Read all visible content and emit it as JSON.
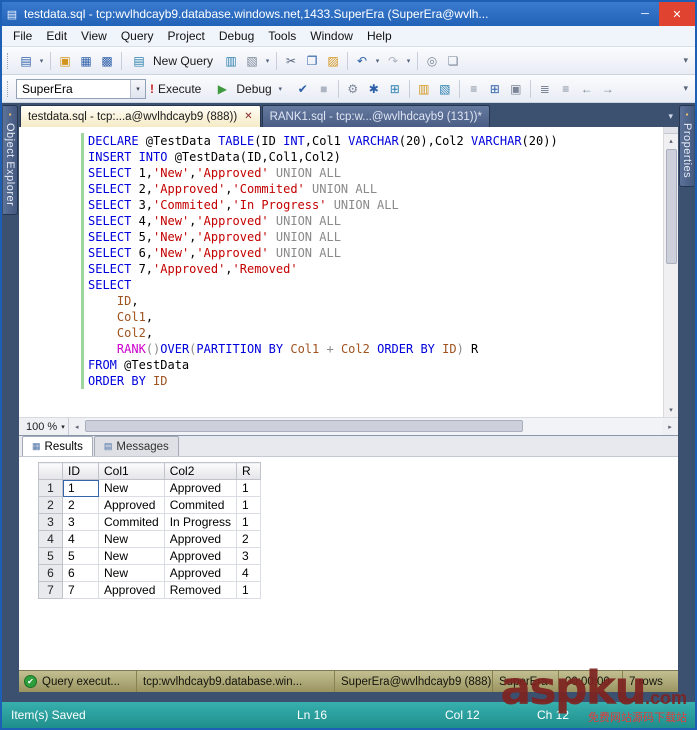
{
  "window": {
    "title": "testdata.sql - tcp:wvlhdcayb9.database.windows.net,1433.SuperEra (SuperEra@wvlh..."
  },
  "menu_bar": {
    "items": [
      "File",
      "Edit",
      "View",
      "Query",
      "Project",
      "Debug",
      "Tools",
      "Window",
      "Help"
    ]
  },
  "toolbars": {
    "standard": {
      "new_query_label": "New Query"
    },
    "sql_editor": {
      "database_combo": "SuperEra",
      "execute_label": "Execute",
      "debug_label": "Debug"
    }
  },
  "doc_tabs": [
    {
      "label": "testdata.sql - tcp:...a@wvlhdcayb9 (888))",
      "active": true
    },
    {
      "label": "RANK1.sql - tcp:w...@wvlhdcayb9 (131))*",
      "active": false
    }
  ],
  "side_panels": {
    "left": "Object Explorer",
    "right": "Properties"
  },
  "editor": {
    "zoom": "100 %",
    "lines": [
      [
        [
          "k",
          "DECLARE"
        ],
        [
          "p",
          " @TestData "
        ],
        [
          "k",
          "TABLE"
        ],
        [
          "p",
          "(ID "
        ],
        [
          "k",
          "INT"
        ],
        [
          "p",
          ",Col1 "
        ],
        [
          "k",
          "VARCHAR"
        ],
        [
          "p",
          "(20),Col2 "
        ],
        [
          "k",
          "VARCHAR"
        ],
        [
          "p",
          "(20))"
        ]
      ],
      [
        [
          "k",
          "INSERT INTO"
        ],
        [
          "p",
          " @TestData(ID,Col1,Col2)"
        ]
      ],
      [
        [
          "k",
          "SELECT"
        ],
        [
          "p",
          " 1,"
        ],
        [
          "s",
          "'New'"
        ],
        [
          "p",
          ","
        ],
        [
          "s",
          "'Approved'"
        ],
        [
          "p",
          " "
        ],
        [
          "o",
          "UNION ALL"
        ]
      ],
      [
        [
          "k",
          "SELECT"
        ],
        [
          "p",
          " 2,"
        ],
        [
          "s",
          "'Approved'"
        ],
        [
          "p",
          ","
        ],
        [
          "s",
          "'Commited'"
        ],
        [
          "p",
          " "
        ],
        [
          "o",
          "UNION ALL"
        ]
      ],
      [
        [
          "k",
          "SELECT"
        ],
        [
          "p",
          " 3,"
        ],
        [
          "s",
          "'Commited'"
        ],
        [
          "p",
          ","
        ],
        [
          "s",
          "'In Progress'"
        ],
        [
          "p",
          " "
        ],
        [
          "o",
          "UNION ALL"
        ]
      ],
      [
        [
          "k",
          "SELECT"
        ],
        [
          "p",
          " 4,"
        ],
        [
          "s",
          "'New'"
        ],
        [
          "p",
          ","
        ],
        [
          "s",
          "'Approved'"
        ],
        [
          "p",
          " "
        ],
        [
          "o",
          "UNION ALL"
        ]
      ],
      [
        [
          "k",
          "SELECT"
        ],
        [
          "p",
          " 5,"
        ],
        [
          "s",
          "'New'"
        ],
        [
          "p",
          ","
        ],
        [
          "s",
          "'Approved'"
        ],
        [
          "p",
          " "
        ],
        [
          "o",
          "UNION ALL"
        ]
      ],
      [
        [
          "k",
          "SELECT"
        ],
        [
          "p",
          " 6,"
        ],
        [
          "s",
          "'New'"
        ],
        [
          "p",
          ","
        ],
        [
          "s",
          "'Approved'"
        ],
        [
          "p",
          " "
        ],
        [
          "o",
          "UNION ALL"
        ]
      ],
      [
        [
          "k",
          "SELECT"
        ],
        [
          "p",
          " 7,"
        ],
        [
          "s",
          "'Approved'"
        ],
        [
          "p",
          ","
        ],
        [
          "s",
          "'Removed'"
        ]
      ],
      [
        [
          "k",
          "SELECT"
        ]
      ],
      [
        [
          "p",
          "    "
        ],
        [
          "c",
          "ID"
        ],
        [
          "p",
          ","
        ]
      ],
      [
        [
          "p",
          "    "
        ],
        [
          "c",
          "Col1"
        ],
        [
          "p",
          ","
        ]
      ],
      [
        [
          "p",
          "    "
        ],
        [
          "c",
          "Col2"
        ],
        [
          "p",
          ","
        ]
      ],
      [
        [
          "p",
          "    "
        ],
        [
          "f",
          "RANK"
        ],
        [
          "o",
          "()"
        ],
        [
          "k",
          "OVER"
        ],
        [
          "o",
          "("
        ],
        [
          "k",
          "PARTITION BY"
        ],
        [
          "p",
          " "
        ],
        [
          "c",
          "Col1"
        ],
        [
          "p",
          " "
        ],
        [
          "o",
          "+"
        ],
        [
          "p",
          " "
        ],
        [
          "c",
          "Col2"
        ],
        [
          "p",
          " "
        ],
        [
          "k",
          "ORDER BY"
        ],
        [
          "p",
          " "
        ],
        [
          "c",
          "ID"
        ],
        [
          "o",
          ")"
        ],
        [
          "p",
          " R"
        ]
      ],
      [
        [
          "k",
          "FROM"
        ],
        [
          "p",
          " @TestData"
        ]
      ],
      [
        [
          "k",
          "ORDER BY"
        ],
        [
          "p",
          " "
        ],
        [
          "c",
          "ID"
        ]
      ]
    ]
  },
  "results_pane": {
    "tabs": [
      {
        "label": "Results",
        "active": true
      },
      {
        "label": "Messages",
        "active": false
      }
    ],
    "grid": {
      "columns": [
        "",
        "ID",
        "Col1",
        "Col2",
        "R"
      ],
      "rows": [
        [
          "1",
          "1",
          "New",
          "Approved",
          "1"
        ],
        [
          "2",
          "2",
          "Approved",
          "Commited",
          "1"
        ],
        [
          "3",
          "3",
          "Commited",
          "In Progress",
          "1"
        ],
        [
          "4",
          "4",
          "New",
          "Approved",
          "2"
        ],
        [
          "5",
          "5",
          "New",
          "Approved",
          "3"
        ],
        [
          "6",
          "6",
          "New",
          "Approved",
          "4"
        ],
        [
          "7",
          "7",
          "Approved",
          "Removed",
          "1"
        ]
      ],
      "selected": [
        0,
        1
      ]
    }
  },
  "query_status_bar": {
    "message": "Query execut...",
    "server": "tcp:wvlhdcayb9.database.win...",
    "login": "SuperEra@wvlhdcayb9 (888)",
    "database": "SuperEra",
    "time": "00:00:00",
    "rows": "7 rows"
  },
  "app_status_bar": {
    "message": "Item(s) Saved",
    "ln": "Ln 16",
    "col": "Col 12",
    "ch": "Ch 12"
  },
  "watermark": {
    "brand": "aspku",
    "tld": ".com",
    "caption": "免费网站源码下载站"
  },
  "colors": {
    "titlebar_blue": "#2163b8",
    "close_red": "#e0432f",
    "tabstrip_blue": "#3c5170",
    "status_olive": "#99945f",
    "statusbar_teal": "#1f8e8c",
    "keyword_blue": "#0000dd",
    "string_red": "#c40000",
    "function_magenta": "#cc00cc",
    "success_green": "#2f9e3c"
  },
  "icons": {
    "app": "▤",
    "minimize": "─",
    "close": "✕",
    "caret": "▾",
    "new_file": "▤",
    "open_folder": "▣",
    "save": "▦",
    "save_all": "▩",
    "new_query": "▤",
    "db_query": "▥",
    "mdx_query": "▧",
    "cut": "✂",
    "copy": "❐",
    "paste": "▨",
    "undo": "↶",
    "redo": "↷",
    "activity_monitor": "◎",
    "find": "❏",
    "overflow": "▾",
    "execute_bang": "!",
    "debug_play": "▶",
    "parse_check": "✔",
    "cancel_query": "■",
    "query_options": "⚙",
    "intellisense": "✱",
    "template_params": "⊞",
    "actual_plan": "▥",
    "client_stats": "▧",
    "results_text": "≡",
    "results_grid": "⊞",
    "results_file": "▣",
    "comment": "≣",
    "uncomment": "≡",
    "outdent": "←",
    "indent": "→",
    "tab_close": "✕",
    "results_tab": "▦",
    "messages_tab": "▤",
    "status_check": "✔",
    "pin": "▪",
    "up": "▴",
    "down": "▾",
    "left": "◂",
    "right": "▸"
  }
}
